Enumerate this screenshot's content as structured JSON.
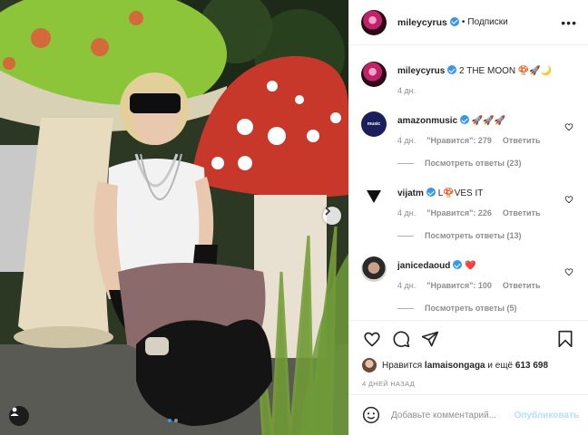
{
  "post": {
    "username": "mileycyrus",
    "separator": "•",
    "follow_label": "Подписки",
    "more_label": "•••",
    "caption": {
      "username": "mileycyrus",
      "text": "2 THE MOON 🍄🚀🌙",
      "time": "4 дн."
    }
  },
  "comments": [
    {
      "username": "amazonmusic",
      "verified": true,
      "text": "🚀🚀🚀",
      "time": "4 дн.",
      "likes": "\"Нравится\": 279",
      "reply": "Ответить",
      "replies": "Посмотреть ответы (23)",
      "avatar_color": "#1a1f5c"
    },
    {
      "username": "vijatm",
      "verified": true,
      "text": "L🍄VES IT",
      "time": "4 дн.",
      "likes": "\"Нравится\": 226",
      "reply": "Ответить",
      "replies": "Посмотреть ответы (13)",
      "avatar_color": "#ffffff"
    },
    {
      "username": "janicedaoud",
      "verified": true,
      "text": "❤️",
      "time": "4 дн.",
      "likes": "\"Нравится\": 100",
      "reply": "Ответить",
      "replies": "Посмотреть ответы (5)",
      "avatar_color": "#d9d2cc"
    }
  ],
  "likes": {
    "prefix": "Нравится",
    "user": "lamaisongaga",
    "middle": "и ещё",
    "count": "613 698"
  },
  "time_ago": "4 ДНЕЙ НАЗАД",
  "add_comment": {
    "placeholder": "Добавьте комментарий...",
    "publish_label": "Опубликовать"
  },
  "colors": {
    "verified": "#3897f0",
    "publish_disabled": "#b2dffc",
    "muted_text": "#8e8e8e"
  },
  "icons": [
    "heart-icon",
    "comment-icon",
    "share-icon",
    "bookmark-icon",
    "emoji-icon",
    "user-tag-icon",
    "chevron-right-icon",
    "verified-icon"
  ]
}
